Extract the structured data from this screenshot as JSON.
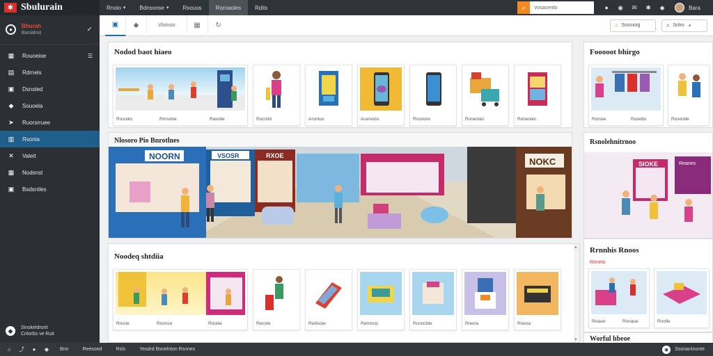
{
  "brand": {
    "logo_glyph": "✱",
    "name": "Sbulurain"
  },
  "user": {
    "name": "Bhurah",
    "sub": "Banialnsi"
  },
  "sidebar": {
    "items": [
      {
        "label": "Rouoeioe",
        "icon": "grid-icon",
        "glyph": "▦"
      },
      {
        "label": "Rdrnels",
        "icon": "list-icon",
        "glyph": "▤"
      },
      {
        "label": "Dsnsted",
        "icon": "folder-icon",
        "glyph": "▣"
      },
      {
        "label": "Souoela",
        "icon": "tag-icon",
        "glyph": "◆"
      },
      {
        "label": "Ruorsrruee",
        "icon": "truck-icon",
        "glyph": "➤"
      },
      {
        "label": "Rsonia",
        "icon": "store-icon",
        "glyph": "▥"
      },
      {
        "label": "Valeit",
        "icon": "shuffle-icon",
        "glyph": "✕"
      },
      {
        "label": "Nodsnst",
        "icon": "calendar-icon",
        "glyph": "▦"
      },
      {
        "label": "Bsdsntles",
        "icon": "box-icon",
        "glyph": "▣"
      }
    ],
    "active_index": 5,
    "footer": {
      "line1": "Sinskeldrorit",
      "line2": "Cnlorbs ve Ruit"
    }
  },
  "topbar": {
    "tabs": [
      {
        "label": "Rnoio",
        "caret": "▾"
      },
      {
        "label": "Bdnsonse",
        "caret": "▾"
      },
      {
        "label": "Rsouos",
        "caret": ""
      },
      {
        "label": "Roroaoles",
        "caret": ""
      },
      {
        "label": "Rdits",
        "caret": ""
      }
    ],
    "active_tab": 3,
    "search_glyph": "⌕",
    "search_placeholder": "Vosaoredo",
    "user_name": "Bara"
  },
  "toolbar": {
    "label1": "Vloiosio",
    "filter_label": "Sosnioig",
    "dropdown_label": "Snlro"
  },
  "main": {
    "panel1": {
      "title": "Nodod baot hiaeo",
      "cards": [
        "Rosoiks",
        "Rrnsohe",
        "Rasoile",
        "Rocnitd",
        "Aroniuo",
        "Acenoins",
        "Rrostore",
        "Roneolec"
      ]
    },
    "panel2": {
      "title": "Nlosoro Pio Bnrotlnes",
      "sign1": "NOORN",
      "sign2": "VSOSR",
      "sign3": "RXOE",
      "sign4": "NOKC"
    },
    "panel3": {
      "title": "Noodeq shtdiia",
      "cards": [
        "Rnsrie",
        "Rnorice",
        "Rnoiiie",
        "Recote",
        "Reiitsoie",
        "Remncis",
        "Rcnnctde",
        "Rneoa"
      ]
    }
  },
  "right": {
    "panel1": {
      "title": "Fooooot bhirgo",
      "cards": [
        "Ronsie",
        "Rosetto",
        "Rnsootle"
      ]
    },
    "panel2": {
      "title": "Rsnolehnitrnoo",
      "sign1": "SIOKE",
      "sign2": "Reanes"
    },
    "panel3": {
      "title": "Rrnnhis Rnoos",
      "subtitle": "Roneto",
      "cards": [
        "Rnaoe",
        "Ronaoe",
        "Rnofle"
      ]
    },
    "panel4": {
      "title": "Worful hbeoe"
    }
  },
  "statusbar": {
    "items": [
      "Bnn",
      "Reesoed",
      "Rsls",
      "Yesdrd Bsnelnton Rsnnes"
    ],
    "right_text": "Ssonanlnonte"
  }
}
